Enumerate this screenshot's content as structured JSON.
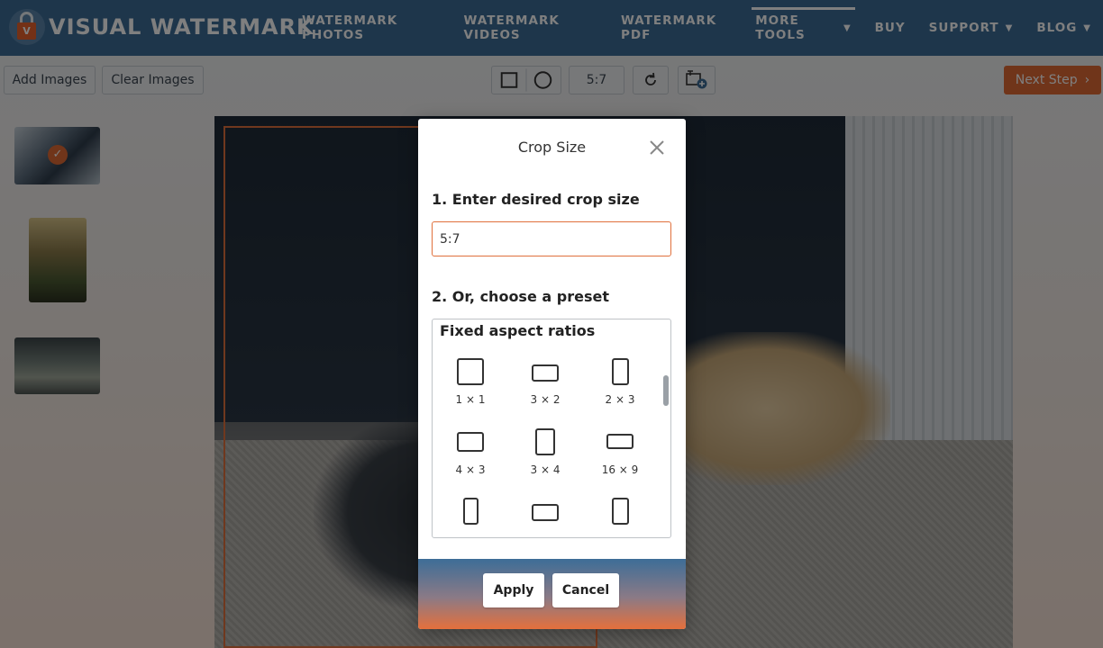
{
  "brand": {
    "name": "VISUAL WATERMARK",
    "logo_letter": "V"
  },
  "nav": [
    {
      "label": "WATERMARK PHOTOS",
      "dropdown": false
    },
    {
      "label": "WATERMARK VIDEOS",
      "dropdown": false
    },
    {
      "label": "WATERMARK PDF",
      "dropdown": false
    },
    {
      "label": "MORE TOOLS",
      "dropdown": true,
      "active": true
    },
    {
      "label": "BUY",
      "dropdown": false
    },
    {
      "label": "SUPPORT",
      "dropdown": true
    },
    {
      "label": "BLOG",
      "dropdown": true
    }
  ],
  "toolbar": {
    "add_images": "Add Images",
    "clear_images": "Clear Images",
    "ratio_value": "5:7",
    "next_step": "Next Step",
    "next_chevron": "›"
  },
  "dialog": {
    "title": "Crop Size",
    "step1_label": "1. Enter desired crop size",
    "crop_size_value": "5:7",
    "step2_label": "2. Or, choose a preset",
    "preset_group_heading": "Fixed aspect ratios",
    "presets": [
      {
        "label": "1 × 1"
      },
      {
        "label": "3 × 2"
      },
      {
        "label": "2 × 3"
      },
      {
        "label": "4 × 3"
      },
      {
        "label": "3 × 4"
      },
      {
        "label": "16 × 9"
      }
    ],
    "apply_label": "Apply",
    "cancel_label": "Cancel"
  },
  "colors": {
    "header_bg": "#3d6d97",
    "accent": "#e06a35"
  }
}
